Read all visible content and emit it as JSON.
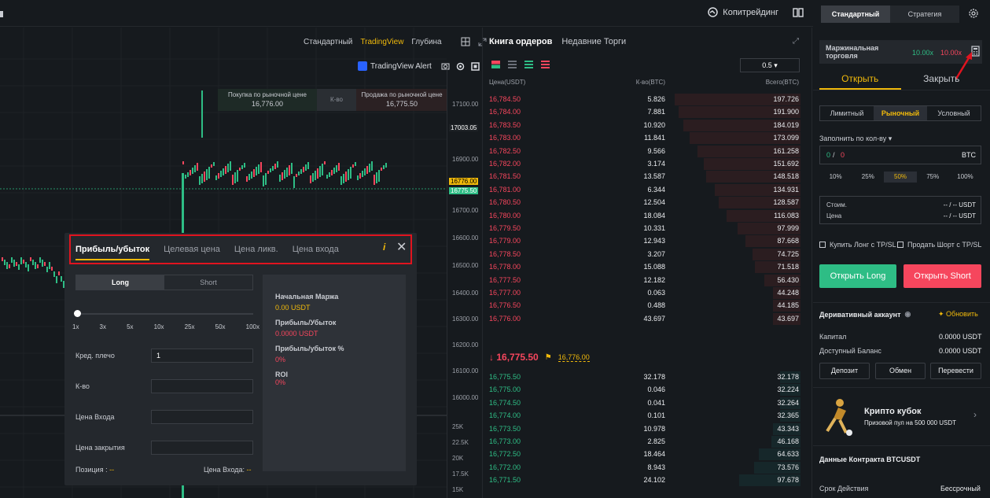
{
  "topbar": {
    "copy_trading": "Копитрейдинг"
  },
  "chart": {
    "tabs": [
      "Стандартный",
      "TradingView",
      "Глубина"
    ],
    "active_tab": "TradingView",
    "tv_alert": "TradingView Alert",
    "market_buy_label": "Покупка по рыночной цене",
    "market_buy_price": "16,776.00",
    "market_qty_label": "К-во",
    "market_sell_label": "Продажа по рыночной цене",
    "market_sell_price": "16,775.50",
    "price_ticks": [
      "17100.00",
      "17003.05",
      "16900.00",
      "16776.00",
      "16775.50",
      "16700.00",
      "16600.00",
      "16500.00",
      "16400.00",
      "16300.00",
      "16200.00",
      "16100.00",
      "16000.00",
      "25K",
      "22.5K",
      "20K",
      "17.5K",
      "15K"
    ],
    "current_price_tag": "16775.50",
    "mark_price_tag": "16776.00",
    "high_tag": "17003.05"
  },
  "calculator": {
    "tabs": [
      "Прибыль/убыток",
      "Целевая цена",
      "Цена ликв.",
      "Цена входа"
    ],
    "active_tab": "Прибыль/убыток",
    "side_long": "Long",
    "side_short": "Short",
    "leverage_ticks": [
      "1x",
      "3x",
      "5x",
      "10x",
      "25x",
      "50x",
      "100x"
    ],
    "fields": {
      "leverage_label": "Кред. плечо",
      "leverage_value": "1",
      "qty_label": "К-во",
      "entry_label": "Цена Входа",
      "close_label": "Цена закрытия"
    },
    "position_label": "Позиция :",
    "position_value": "--",
    "entry_price_label": "Цена Входа:",
    "entry_price_value": "--",
    "results": {
      "initial_margin_label": "Начальная Маржа",
      "initial_margin_value": "0.00 USDT",
      "pnl_label": "Прибыль/Убыток",
      "pnl_value": "0.0000 USDT",
      "pnl_pct_label": "Прибыль/убыток %",
      "pnl_pct_value": "0%",
      "roi_label": "ROI",
      "roi_value": "0%"
    }
  },
  "orderbook": {
    "tabs": [
      "Книга ордеров",
      "Недавние Торги"
    ],
    "step": "0.5",
    "headers": {
      "price": "Цена(USDT)",
      "qty": "К-во(BTC)",
      "total": "Всего(BTC)"
    },
    "asks": [
      {
        "p": "16,784.50",
        "q": "5.826",
        "t": "197.726",
        "d": 1.0
      },
      {
        "p": "16,784.00",
        "q": "7.881",
        "t": "191.900",
        "d": 0.97
      },
      {
        "p": "16,783.50",
        "q": "10.920",
        "t": "184.019",
        "d": 0.93
      },
      {
        "p": "16,783.00",
        "q": "11.841",
        "t": "173.099",
        "d": 0.88
      },
      {
        "p": "16,782.50",
        "q": "9.566",
        "t": "161.258",
        "d": 0.82
      },
      {
        "p": "16,782.00",
        "q": "3.174",
        "t": "151.692",
        "d": 0.77
      },
      {
        "p": "16,781.50",
        "q": "13.587",
        "t": "148.518",
        "d": 0.75
      },
      {
        "p": "16,781.00",
        "q": "6.344",
        "t": "134.931",
        "d": 0.68
      },
      {
        "p": "16,780.50",
        "q": "12.504",
        "t": "128.587",
        "d": 0.65
      },
      {
        "p": "16,780.00",
        "q": "18.084",
        "t": "116.083",
        "d": 0.59
      },
      {
        "p": "16,779.50",
        "q": "10.331",
        "t": "97.999",
        "d": 0.5
      },
      {
        "p": "16,779.00",
        "q": "12.943",
        "t": "87.668",
        "d": 0.44
      },
      {
        "p": "16,778.50",
        "q": "3.207",
        "t": "74.725",
        "d": 0.38
      },
      {
        "p": "16,778.00",
        "q": "15.088",
        "t": "71.518",
        "d": 0.36
      },
      {
        "p": "16,777.50",
        "q": "12.182",
        "t": "56.430",
        "d": 0.29
      },
      {
        "p": "16,777.00",
        "q": "0.063",
        "t": "44.248",
        "d": 0.22
      },
      {
        "p": "16,776.50",
        "q": "0.488",
        "t": "44.185",
        "d": 0.22
      },
      {
        "p": "16,776.00",
        "q": "43.697",
        "t": "43.697",
        "d": 0.22
      }
    ],
    "last_price": "16,775.50",
    "mark_price": "16,776.00",
    "bids": [
      {
        "p": "16,775.50",
        "q": "32.178",
        "t": "32.178",
        "d": 0.16
      },
      {
        "p": "16,775.00",
        "q": "0.046",
        "t": "32.224",
        "d": 0.16
      },
      {
        "p": "16,774.50",
        "q": "0.041",
        "t": "32.264",
        "d": 0.16
      },
      {
        "p": "16,774.00",
        "q": "0.101",
        "t": "32.365",
        "d": 0.16
      },
      {
        "p": "16,773.50",
        "q": "10.978",
        "t": "43.343",
        "d": 0.22
      },
      {
        "p": "16,773.00",
        "q": "2.825",
        "t": "46.168",
        "d": 0.23
      },
      {
        "p": "16,772.50",
        "q": "18.464",
        "t": "64.633",
        "d": 0.33
      },
      {
        "p": "16,772.00",
        "q": "8.943",
        "t": "73.576",
        "d": 0.37
      },
      {
        "p": "16,771.50",
        "q": "24.102",
        "t": "97.678",
        "d": 0.49
      }
    ]
  },
  "right_panel": {
    "mode_tabs": [
      "Стандартный",
      "Стратегия"
    ],
    "margin_label": "Маржинальная торговля",
    "margin_long": "10.00x",
    "margin_short": "10.00x",
    "open_tab": "Открыть",
    "close_tab": "Закрыть",
    "order_types": [
      "Лимитный",
      "Рыночный",
      "Условный"
    ],
    "fill_label": "Заполнить по кол-ву",
    "fill_value_a": "0",
    "fill_value_b": "0",
    "fill_unit": "BTC",
    "percents": [
      "10%",
      "25%",
      "50%",
      "75%",
      "100%"
    ],
    "cost_label": "Стоим.",
    "cost_value": "-- / -- USDT",
    "price_label": "Цена",
    "price_value": "-- / -- USDT",
    "tp_long": "Купить Лонг с TP/SL",
    "tp_short": "Продать Шорт с TP/SL",
    "open_long": "Открыть Long",
    "open_short": "Открыть Short",
    "account_title": "Деривативный аккаунт",
    "refresh": "Обновить",
    "capital_label": "Капитал",
    "capital_value": "0.0000 USDT",
    "available_label": "Доступный Баланс",
    "available_value": "0.0000 USDT",
    "deposit": "Депозит",
    "exchange": "Обмен",
    "transfer": "Перевести",
    "promo_title": "Крипто кубок",
    "promo_sub": "Призовой пул на 500 000 USDT",
    "contract_title": "Данные Контракта BTCUSDT",
    "term_label": "Срок Действия",
    "term_value": "Бессрочный"
  }
}
